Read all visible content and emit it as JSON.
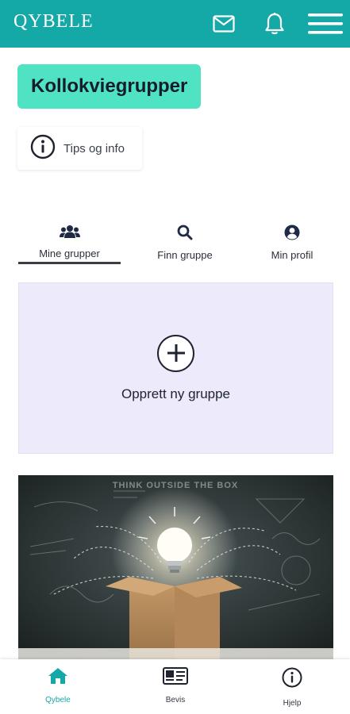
{
  "header": {
    "logo": "QYBELE",
    "icons": [
      "mail-icon",
      "bell-icon",
      "hamburger-menu-icon"
    ],
    "color": "#14a8a6"
  },
  "page": {
    "title": "Kollokviegrupper",
    "title_color": "#4fe3c4"
  },
  "tips": {
    "label": "Tips og info",
    "icon": "info-icon"
  },
  "tabs": [
    {
      "label": "Mine grupper",
      "icon": "group-icon",
      "active": true
    },
    {
      "label": "Finn gruppe",
      "icon": "search-icon",
      "active": false
    },
    {
      "label": "Min profil",
      "icon": "profile-icon",
      "active": false
    }
  ],
  "create_group": {
    "label": "Opprett ny gruppe",
    "icon": "plus-icon",
    "background": "#eceafb"
  },
  "hero": {
    "caption": "THINK OUTSIDE THE BOX"
  },
  "bottom_nav": [
    {
      "label": "Qybele",
      "icon": "home-icon",
      "active": true
    },
    {
      "label": "Bevis",
      "icon": "id-card-icon",
      "active": false
    },
    {
      "label": "Hjelp",
      "icon": "help-info-icon",
      "active": false
    }
  ]
}
